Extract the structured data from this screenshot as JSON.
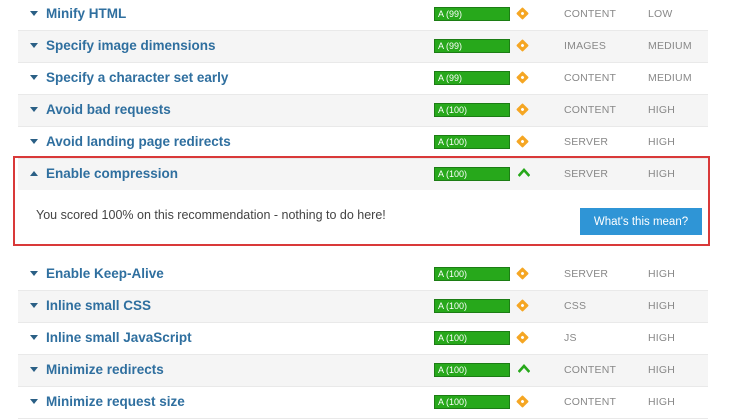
{
  "colors": {
    "accent": "#2f95d6",
    "grade_green": "#27a81b",
    "warning_orange": "#f5a623",
    "highlight_red": "#d93939",
    "title_blue": "#2f6f9f"
  },
  "recommendations": [
    {
      "title": "Minify HTML",
      "grade": "A (99)",
      "icon": "warning-diamond-icon",
      "category": "CONTENT",
      "priority": "LOW"
    },
    {
      "title": "Specify image dimensions",
      "grade": "A (99)",
      "icon": "warning-diamond-icon",
      "category": "IMAGES",
      "priority": "MEDIUM"
    },
    {
      "title": "Specify a character set early",
      "grade": "A (99)",
      "icon": "warning-diamond-icon",
      "category": "CONTENT",
      "priority": "MEDIUM"
    },
    {
      "title": "Avoid bad requests",
      "grade": "A (100)",
      "icon": "warning-diamond-icon",
      "category": "CONTENT",
      "priority": "HIGH"
    },
    {
      "title": "Avoid landing page redirects",
      "grade": "A (100)",
      "icon": "warning-diamond-icon",
      "category": "SERVER",
      "priority": "HIGH"
    },
    {
      "title": "Enable compression",
      "grade": "A (100)",
      "icon": "chevron-up-icon",
      "category": "SERVER",
      "priority": "HIGH",
      "expanded": true
    },
    {
      "title": "Enable Keep-Alive",
      "grade": "A (100)",
      "icon": "warning-diamond-icon",
      "category": "SERVER",
      "priority": "HIGH"
    },
    {
      "title": "Inline small CSS",
      "grade": "A (100)",
      "icon": "warning-diamond-icon",
      "category": "CSS",
      "priority": "HIGH"
    },
    {
      "title": "Inline small JavaScript",
      "grade": "A (100)",
      "icon": "warning-diamond-icon",
      "category": "JS",
      "priority": "HIGH"
    },
    {
      "title": "Minimize redirects",
      "grade": "A (100)",
      "icon": "chevron-up-icon",
      "category": "CONTENT",
      "priority": "HIGH"
    },
    {
      "title": "Minimize request size",
      "grade": "A (100)",
      "icon": "warning-diamond-icon",
      "category": "CONTENT",
      "priority": "HIGH"
    }
  ],
  "expanded_detail": {
    "message": "You scored 100% on this recommendation - nothing to do here!",
    "button_label": "What's this mean?"
  }
}
